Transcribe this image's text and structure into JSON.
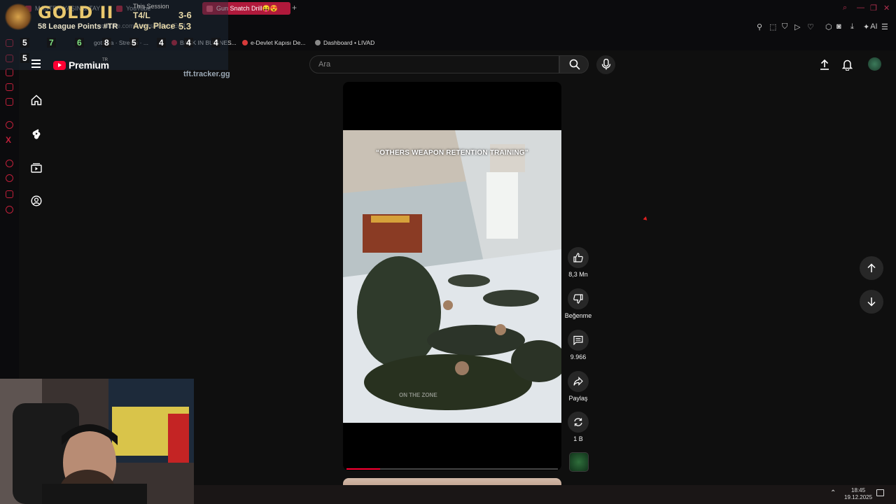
{
  "browser": {
    "tabs": [
      {
        "label": "MASTER YAŞIN & TAY |"
      },
      {
        "label": "YouTube"
      },
      {
        "label": "Gun Snatch Drill😝😍"
      }
    ],
    "new_tab": "+",
    "address_fragment": "youtube.com/shorts/NKleqjEw4",
    "bookmarks": [
      {
        "label": "gotitrea · Stream · ..."
      },
      {
        "label": "BACK IN BUSINES..."
      },
      {
        "label": "e-Devlet Kapısı De..."
      },
      {
        "label": "Dashboard • LIVAD"
      }
    ],
    "toolbar_ai_label": "AI",
    "accent_color": "#b0193b"
  },
  "tft_overlay": {
    "rank": "GOLD II",
    "league_points": "58 League Points #TR",
    "session_label": "This Session",
    "tl_label": "T4/L",
    "tl_value": "3-6",
    "avg_label": "Avg. Place",
    "avg_value": "5.3",
    "placements": [
      "5",
      "7",
      "6",
      "8",
      "5",
      "4",
      "4",
      "4",
      "5"
    ],
    "tracker": "tft.tracker.gg"
  },
  "youtube": {
    "logo_text": "Premium",
    "region": "TR",
    "search": {
      "placeholder": "Ara",
      "value": ""
    },
    "sidebar": [
      {
        "icon": "home-icon"
      },
      {
        "icon": "shorts-icon"
      },
      {
        "icon": "subscriptions-icon"
      },
      {
        "icon": "you-icon"
      }
    ],
    "short": {
      "caption": "“OTHERS WEAPON RETENTION TRAINING”",
      "watermark": "ON THE ZONE",
      "progress": 0.16
    },
    "actions": {
      "like": "8,3 Mn",
      "dislike": "Beğenme",
      "comments": "9.966",
      "share": "Paylaş",
      "remix": "1 B"
    },
    "brand_color": "#ff0033"
  },
  "taskbar": {
    "time": "18:45",
    "date": "19.12.2025"
  }
}
